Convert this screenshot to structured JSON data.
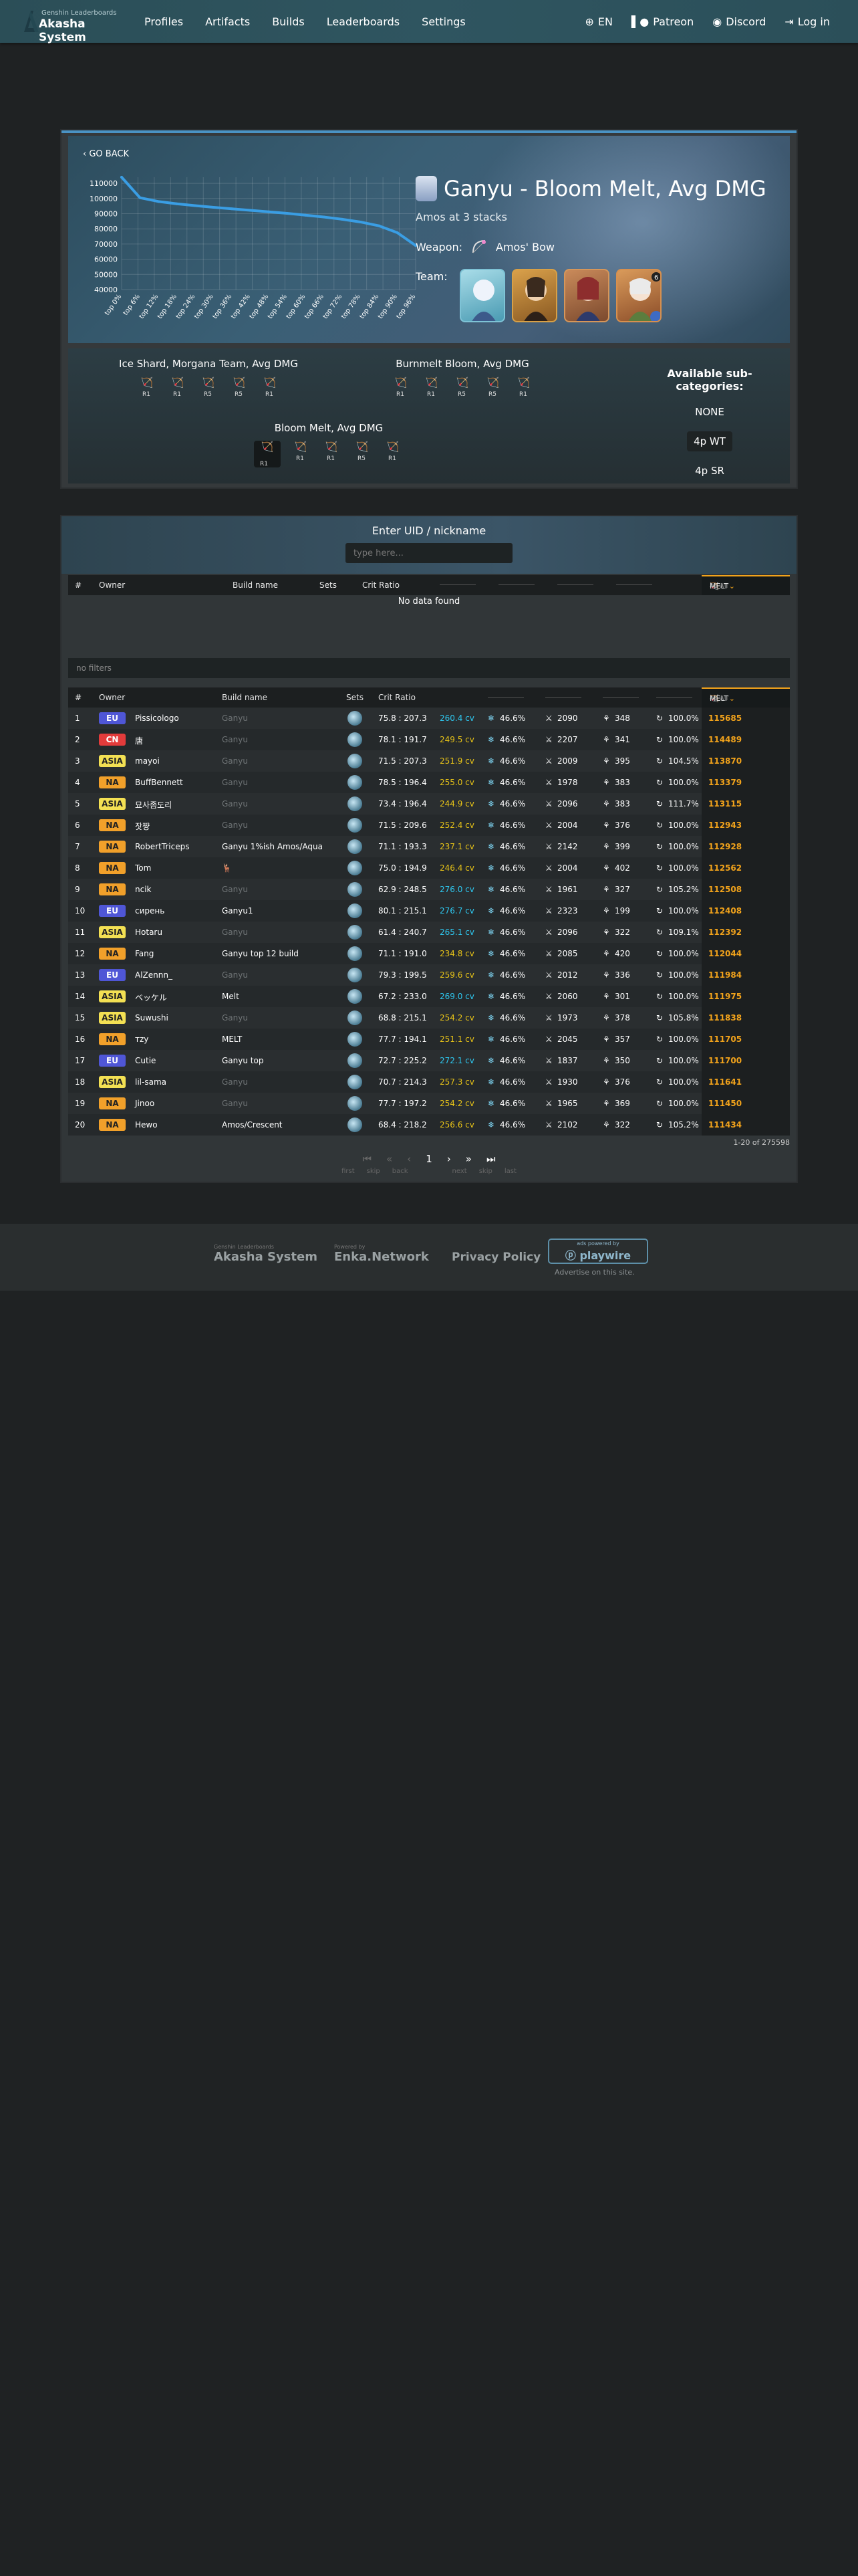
{
  "nav": {
    "logo_small": "Genshin Leaderboards",
    "logo_big": "Akasha System",
    "links": [
      "Profiles",
      "Artifacts",
      "Builds",
      "Leaderboards",
      "Settings"
    ],
    "lang": "EN",
    "patreon": "Patreon",
    "discord": "Discord",
    "login": "Log in"
  },
  "hero": {
    "go_back": "GO BACK",
    "title": "Ganyu - Bloom Melt, Avg DMG",
    "subtitle": "Amos at 3 stacks",
    "weapon_label": "Weapon:",
    "weapon": "Amos' Bow",
    "team_label": "Team:",
    "team_icons": [
      "ganyu-icon",
      "zhongli-icon",
      "nilou-icon",
      "nahida-icon"
    ]
  },
  "chart_data": {
    "type": "line",
    "x": [
      "top 0%",
      "top 6%",
      "top 12%",
      "top 18%",
      "top 24%",
      "top 30%",
      "top 36%",
      "top 42%",
      "top 48%",
      "top 54%",
      "top 60%",
      "top 66%",
      "top 72%",
      "top 78%",
      "top 84%",
      "top 90%",
      "top 96%"
    ],
    "y": [
      114000,
      100500,
      98000,
      96500,
      95300,
      94200,
      93200,
      92200,
      91200,
      90200,
      89000,
      87800,
      86300,
      84500,
      82000,
      77500,
      69000
    ],
    "y_ticks": [
      "110000",
      "100000",
      "90000",
      "80000",
      "70000",
      "60000",
      "50000",
      "40000"
    ],
    "ylim": [
      40000,
      114000
    ],
    "grid": true,
    "color": "#3a9ee4"
  },
  "categories": [
    {
      "name": "Ice Shard, Morgana Team, Avg DMG",
      "ranks": [
        "R1",
        "R1",
        "R5",
        "R5",
        "R1"
      ]
    },
    {
      "name": "Burnmelt Bloom, Avg DMG",
      "ranks": [
        "R1",
        "R1",
        "R5",
        "R5",
        "R1"
      ]
    },
    {
      "name": "Bloom Melt, Avg DMG",
      "ranks": [
        "R1",
        "R1",
        "R1",
        "R5",
        "R1"
      ]
    }
  ],
  "subcats": {
    "heading": "Available sub-categories:",
    "options": [
      "NONE",
      "4p WT",
      "4p SR"
    ],
    "selected": "4p WT"
  },
  "lookup": {
    "title": "Enter UID / nickname",
    "placeholder": "type here...",
    "no_data": "No data found",
    "filters": "no filters",
    "cols": {
      "rank": "#",
      "owner": "Owner",
      "build": "Build name",
      "sets": "Sets",
      "crit": "Crit Ratio",
      "metric": "MELT",
      "metric_sub": "4p WT"
    }
  },
  "rows": [
    {
      "r": "1",
      "region": "EU",
      "owner": "Pissicologo",
      "build": "Ganyu",
      "crit": "75.8 : 207.3",
      "cv": "260.4 cv",
      "cvc": "b",
      "ew": "46.6%",
      "atk": "2090",
      "em": "348",
      "er": "100.0%",
      "dmg": "115685"
    },
    {
      "r": "2",
      "region": "CN",
      "owner": "唐",
      "build": "Ganyu",
      "crit": "78.1 : 191.7",
      "cv": "249.5 cv",
      "cvc": "y",
      "ew": "46.6%",
      "atk": "2207",
      "em": "341",
      "er": "100.0%",
      "dmg": "114489"
    },
    {
      "r": "3",
      "region": "ASIA",
      "owner": "mayoi",
      "build": "Ganyu",
      "crit": "71.5 : 207.3",
      "cv": "251.9 cv",
      "cvc": "y",
      "ew": "46.6%",
      "atk": "2009",
      "em": "395",
      "er": "104.5%",
      "dmg": "113870"
    },
    {
      "r": "4",
      "region": "NA",
      "owner": "BuffBennett",
      "build": "Ganyu",
      "crit": "78.5 : 196.4",
      "cv": "255.0 cv",
      "cvc": "y",
      "ew": "46.6%",
      "atk": "1978",
      "em": "383",
      "er": "100.0%",
      "dmg": "113379"
    },
    {
      "r": "5",
      "region": "ASIA",
      "owner": "묘사좀도리",
      "build": "Ganyu",
      "crit": "73.4 : 196.4",
      "cv": "244.9 cv",
      "cvc": "y",
      "ew": "46.6%",
      "atk": "2096",
      "em": "383",
      "er": "111.7%",
      "dmg": "113115"
    },
    {
      "r": "6",
      "region": "NA",
      "owner": "잣쨩",
      "build": "Ganyu",
      "crit": "71.5 : 209.6",
      "cv": "252.4 cv",
      "cvc": "y",
      "ew": "46.6%",
      "atk": "2004",
      "em": "376",
      "er": "100.0%",
      "dmg": "112943"
    },
    {
      "r": "7",
      "region": "NA",
      "owner": "RobertTriceps",
      "build": "Ganyu 1%ish Amos/Aqua",
      "crit": "71.1 : 193.3",
      "cv": "237.1 cv",
      "cvc": "y",
      "ew": "46.6%",
      "atk": "2142",
      "em": "399",
      "er": "100.0%",
      "dmg": "112928"
    },
    {
      "r": "8",
      "region": "NA",
      "owner": "Tom",
      "build": "🦌",
      "crit": "75.0 : 194.9",
      "cv": "246.4 cv",
      "cvc": "y",
      "ew": "46.6%",
      "atk": "2004",
      "em": "402",
      "er": "100.0%",
      "dmg": "112562"
    },
    {
      "r": "9",
      "region": "NA",
      "owner": "ncik",
      "build": "Ganyu",
      "crit": "62.9 : 248.5",
      "cv": "276.0 cv",
      "cvc": "b",
      "ew": "46.6%",
      "atk": "1961",
      "em": "327",
      "er": "105.2%",
      "dmg": "112508"
    },
    {
      "r": "10",
      "region": "EU",
      "owner": "сирень",
      "build": "Ganyu1",
      "crit": "80.1 : 215.1",
      "cv": "276.7 cv",
      "cvc": "b",
      "ew": "46.6%",
      "atk": "2323",
      "em": "199",
      "er": "100.0%",
      "dmg": "112408"
    },
    {
      "r": "11",
      "region": "ASIA",
      "owner": "Hotaru",
      "build": "Ganyu",
      "crit": "61.4 : 240.7",
      "cv": "265.1 cv",
      "cvc": "b",
      "ew": "46.6%",
      "atk": "2096",
      "em": "322",
      "er": "109.1%",
      "dmg": "112392"
    },
    {
      "r": "12",
      "region": "NA",
      "owner": "Fang",
      "build": "Ganyu top 12 build",
      "crit": "71.1 : 191.0",
      "cv": "234.8 cv",
      "cvc": "y",
      "ew": "46.6%",
      "atk": "2085",
      "em": "420",
      "er": "100.0%",
      "dmg": "112044"
    },
    {
      "r": "13",
      "region": "EU",
      "owner": "AlZennn_",
      "build": "Ganyu",
      "crit": "79.3 : 199.5",
      "cv": "259.6 cv",
      "cvc": "y",
      "ew": "46.6%",
      "atk": "2012",
      "em": "336",
      "er": "100.0%",
      "dmg": "111984"
    },
    {
      "r": "14",
      "region": "ASIA",
      "owner": "ベッケル",
      "build": "Melt",
      "crit": "67.2 : 233.0",
      "cv": "269.0 cv",
      "cvc": "b",
      "ew": "46.6%",
      "atk": "2060",
      "em": "301",
      "er": "100.0%",
      "dmg": "111975"
    },
    {
      "r": "15",
      "region": "ASIA",
      "owner": "Suwushi",
      "build": "Ganyu",
      "crit": "68.8 : 215.1",
      "cv": "254.2 cv",
      "cvc": "y",
      "ew": "46.6%",
      "atk": "1973",
      "em": "378",
      "er": "105.8%",
      "dmg": "111838"
    },
    {
      "r": "16",
      "region": "NA",
      "owner": "тzу",
      "build": "MELT",
      "crit": "77.7 : 194.1",
      "cv": "251.1 cv",
      "cvc": "y",
      "ew": "46.6%",
      "atk": "2045",
      "em": "357",
      "er": "100.0%",
      "dmg": "111705"
    },
    {
      "r": "17",
      "region": "EU",
      "owner": "Cutie",
      "build": "Ganyu top",
      "crit": "72.7 : 225.2",
      "cv": "272.1 cv",
      "cvc": "b",
      "ew": "46.6%",
      "atk": "1837",
      "em": "350",
      "er": "100.0%",
      "dmg": "111700"
    },
    {
      "r": "18",
      "region": "ASIA",
      "owner": "lil-sama",
      "build": "Ganyu",
      "crit": "70.7 : 214.3",
      "cv": "257.3 cv",
      "cvc": "y",
      "ew": "46.6%",
      "atk": "1930",
      "em": "376",
      "er": "100.0%",
      "dmg": "111641"
    },
    {
      "r": "19",
      "region": "NA",
      "owner": "Jinoo",
      "build": "Ganyu",
      "crit": "77.7 : 197.2",
      "cv": "254.2 cv",
      "cvc": "y",
      "ew": "46.6%",
      "atk": "1965",
      "em": "369",
      "er": "100.0%",
      "dmg": "111450"
    },
    {
      "r": "20",
      "region": "NA",
      "owner": "Hewo",
      "build": "Amos/Crescent",
      "crit": "68.4 : 218.2",
      "cv": "256.6 cv",
      "cvc": "y",
      "ew": "46.6%",
      "atk": "2102",
      "em": "322",
      "er": "105.2%",
      "dmg": "111434"
    }
  ],
  "pager": {
    "total": "1-20 of 275598",
    "page": "1",
    "labels": [
      "first",
      "skip",
      "back",
      "next",
      "skip",
      "last"
    ]
  },
  "footer": {
    "akasha_small": "Genshin Leaderboards",
    "akasha": "Akasha System",
    "enka_small": "Powered by",
    "enka": "Enka.Network",
    "privacy": "Privacy Policy",
    "ads_small": "ads powered by",
    "ads": "playwire",
    "advertise": "Advertise on this site."
  }
}
